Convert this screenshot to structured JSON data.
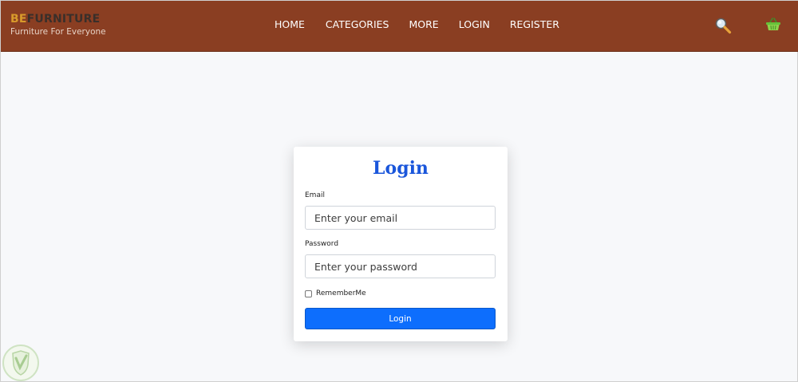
{
  "brand": {
    "prefix": "BE",
    "name": "FURNITURE",
    "tagline": "Furniture For Everyone"
  },
  "nav": {
    "items": [
      {
        "label": "HOME"
      },
      {
        "label": "CATEGORIES"
      },
      {
        "label": "MORE"
      },
      {
        "label": "LOGIN"
      },
      {
        "label": "REGISTER"
      }
    ],
    "search_icon": "magnifier-icon",
    "cart_icon": "shopping-basket-icon"
  },
  "login_form": {
    "title": "Login",
    "email": {
      "label": "Email",
      "placeholder": "Enter your email",
      "value": ""
    },
    "password": {
      "label": "Password",
      "placeholder": "Enter your password",
      "value": ""
    },
    "remember_label": "RememberMe",
    "remember_checked": false,
    "submit_label": "Login"
  },
  "colors": {
    "navbar_bg": "#8a3e22",
    "brand_accent": "#d89a2b",
    "title_blue": "#1a56db",
    "button_blue": "#0d6efd",
    "page_bg": "#f7f8fa"
  }
}
